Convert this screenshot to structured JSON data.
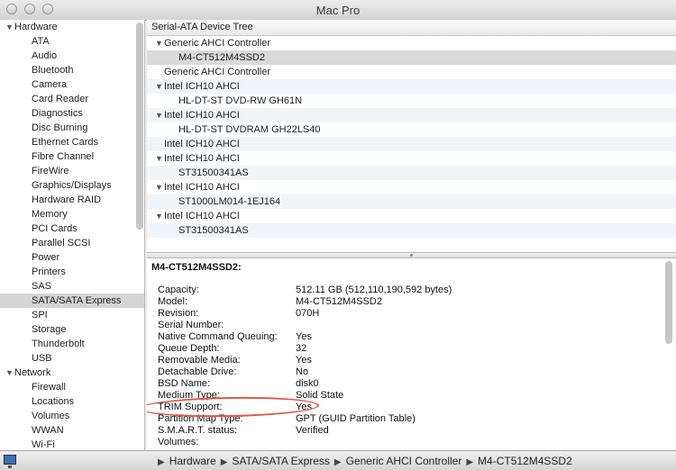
{
  "window": {
    "title": "Mac Pro"
  },
  "sidebar": {
    "hardware_label": "Hardware",
    "hardware_items": [
      "ATA",
      "Audio",
      "Bluetooth",
      "Camera",
      "Card Reader",
      "Diagnostics",
      "Disc Burning",
      "Ethernet Cards",
      "Fibre Channel",
      "FireWire",
      "Graphics/Displays",
      "Hardware RAID",
      "Memory",
      "PCI Cards",
      "Parallel SCSI",
      "Power",
      "Printers",
      "SAS",
      "SATA/SATA Express",
      "SPI",
      "Storage",
      "Thunderbolt",
      "USB"
    ],
    "selected": "SATA/SATA Express",
    "network_label": "Network",
    "network_items": [
      "Firewall",
      "Locations",
      "Volumes",
      "WWAN",
      "Wi-Fi"
    ]
  },
  "tree": {
    "header": "Serial-ATA Device Tree",
    "rows": [
      {
        "label": "Generic AHCI Controller",
        "level": 0,
        "expanded": true
      },
      {
        "label": "M4-CT512M4SSD2",
        "level": 1,
        "selected": true
      },
      {
        "label": "Generic AHCI Controller",
        "level": 0
      },
      {
        "label": "Intel ICH10 AHCI",
        "level": 0,
        "expanded": true
      },
      {
        "label": "HL-DT-ST DVD-RW GH61N",
        "level": 1
      },
      {
        "label": "Intel ICH10 AHCI",
        "level": 0,
        "expanded": true
      },
      {
        "label": "HL-DT-ST DVDRAM GH22LS40",
        "level": 1
      },
      {
        "label": "Intel ICH10 AHCI",
        "level": 0
      },
      {
        "label": "Intel ICH10 AHCI",
        "level": 0,
        "expanded": true
      },
      {
        "label": "ST31500341AS",
        "level": 1
      },
      {
        "label": "Intel ICH10 AHCI",
        "level": 0,
        "expanded": true
      },
      {
        "label": "ST1000LM014-1EJ164",
        "level": 1
      },
      {
        "label": "Intel ICH10 AHCI",
        "level": 0,
        "expanded": true
      },
      {
        "label": "ST31500341AS",
        "level": 1
      }
    ]
  },
  "detail": {
    "title": "M4-CT512M4SSD2:",
    "properties": [
      {
        "name": "Capacity:",
        "value": "512.11 GB (512,110,190,592 bytes)"
      },
      {
        "name": "Model:",
        "value": "M4-CT512M4SSD2"
      },
      {
        "name": "Revision:",
        "value": "070H"
      },
      {
        "name": "Serial Number:",
        "value": ""
      },
      {
        "name": "Native Command Queuing:",
        "value": "Yes"
      },
      {
        "name": "Queue Depth:",
        "value": "32"
      },
      {
        "name": "Removable Media:",
        "value": "Yes"
      },
      {
        "name": "Detachable Drive:",
        "value": "No"
      },
      {
        "name": "BSD Name:",
        "value": "disk0"
      },
      {
        "name": "Medium Type:",
        "value": "Solid State"
      },
      {
        "name": "TRIM Support:",
        "value": "Yes"
      },
      {
        "name": "Partition Map Type:",
        "value": "GPT (GUID Partition Table)"
      },
      {
        "name": "S.M.A.R.T. status:",
        "value": "Verified"
      },
      {
        "name": "Volumes:",
        "value": ""
      }
    ],
    "highlight_color": "#d85c4a"
  },
  "pathbar": {
    "items": [
      "Hardware",
      "SATA/SATA Express",
      "Generic AHCI Controller",
      "M4-CT512M4SSD2"
    ],
    "separator": "▶"
  }
}
